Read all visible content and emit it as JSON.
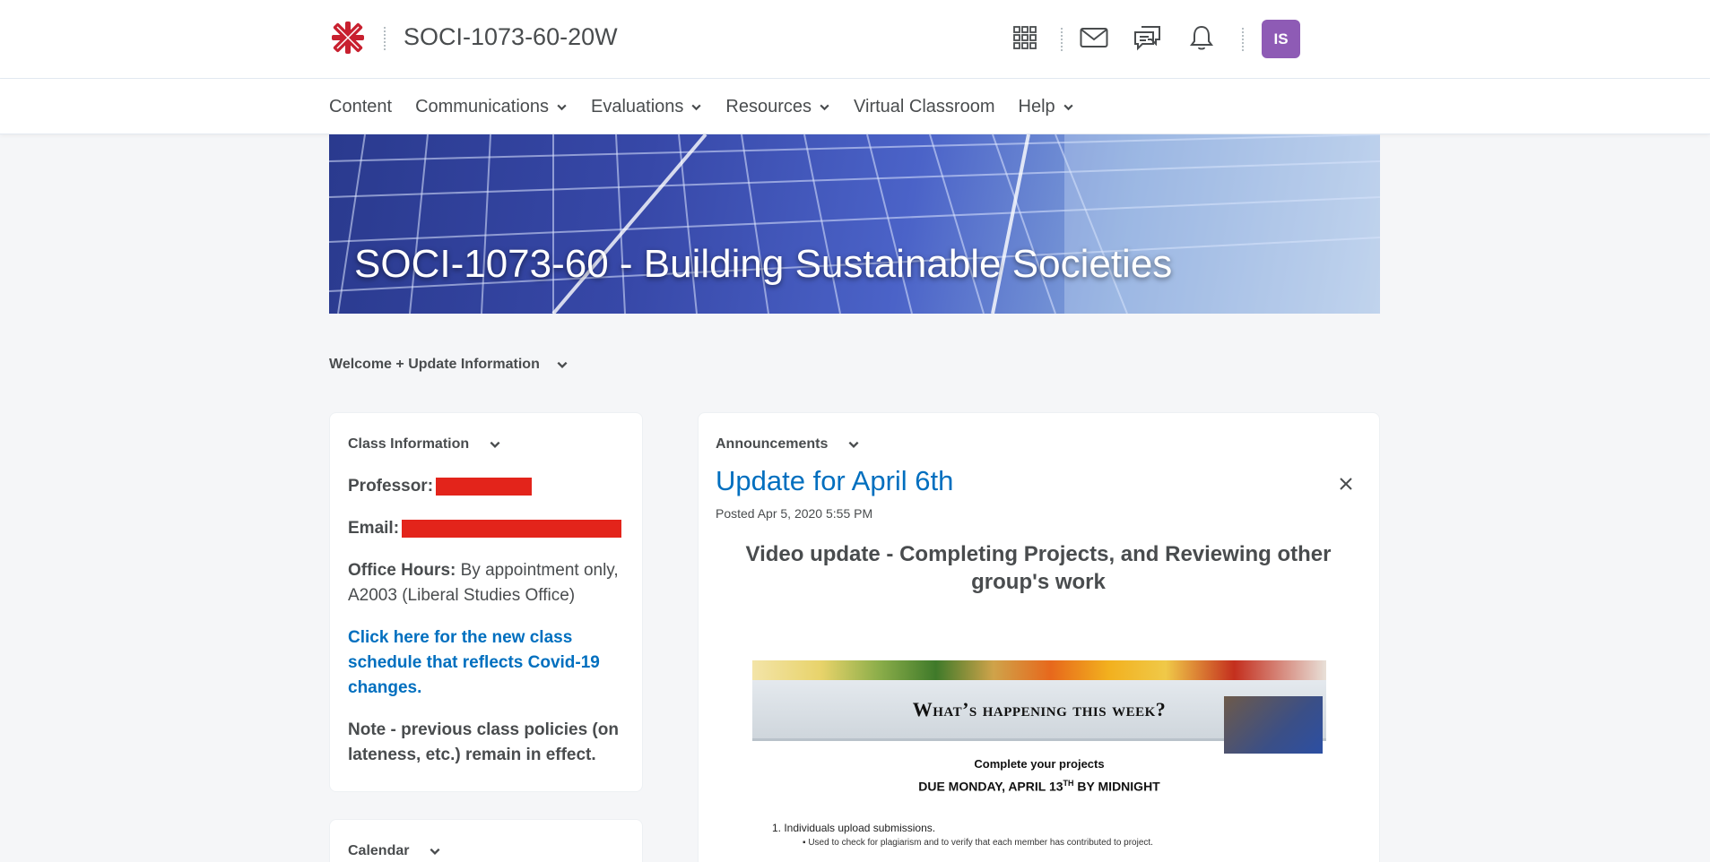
{
  "header": {
    "course_code": "SOCI-1073-60-20W",
    "icons": [
      "logo-icon",
      "waffle-icon",
      "mail-icon",
      "chat-icon",
      "bell-icon"
    ],
    "avatar_initials": "IS",
    "avatar_color": "#8e5bb5"
  },
  "nav": {
    "items": [
      {
        "label": "Content",
        "dropdown": false
      },
      {
        "label": "Communications",
        "dropdown": true
      },
      {
        "label": "Evaluations",
        "dropdown": true
      },
      {
        "label": "Resources",
        "dropdown": true
      },
      {
        "label": "Virtual Classroom",
        "dropdown": false
      },
      {
        "label": "Help",
        "dropdown": true
      }
    ]
  },
  "banner": {
    "title": "SOCI-1073-60 - Building Sustainable Societies"
  },
  "welcome_widget": {
    "label": "Welcome + Update Information"
  },
  "class_info": {
    "heading": "Class Information",
    "professor_label": "Professor:",
    "email_label": "Email:",
    "office_hours_label": "Office Hours:",
    "office_hours_value": " By appointment only, A2003 (Liberal Studies Office)",
    "schedule_link": "Click here for the new class schedule that reflects Covid-19 changes.",
    "note": "Note - previous class policies (on lateness, etc.) remain in effect."
  },
  "calendar": {
    "heading": "Calendar"
  },
  "announcements": {
    "heading": "Announcements",
    "title": "Update for April 6th",
    "posted": "Posted Apr 5, 2020 5:55 PM",
    "subheading": "Video update - Completing Projects, and Reviewing other group's work",
    "image": {
      "banner_text": "What’s happening this week?",
      "line1": "Complete your projects",
      "line2_prefix": "DUE MONDAY, APRIL 13",
      "line2_sup": "TH",
      "line2_suffix": " BY MIDNIGHT",
      "item1": "1.   Individuals upload submissions.",
      "item1_sub": "▪  Used to check for plagiarism and to verify that each member has contributed to project."
    }
  },
  "colors": {
    "link": "#006fbf",
    "text": "#494c4e",
    "redaction": "#e3241b",
    "logo_red": "#c8202f"
  }
}
